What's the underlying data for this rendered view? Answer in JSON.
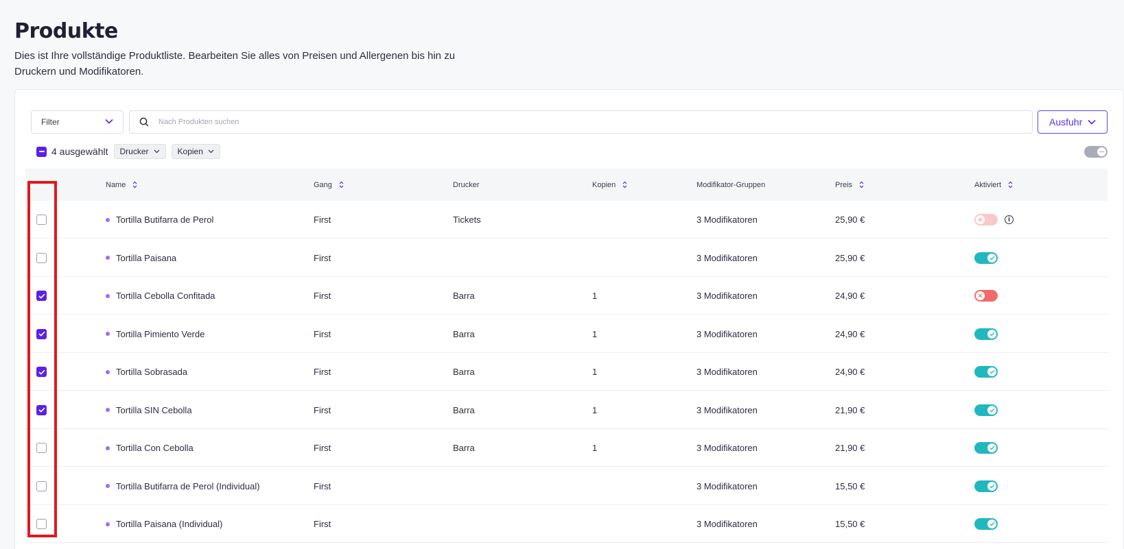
{
  "page": {
    "title": "Produkte",
    "description": "Dies ist Ihre vollständige Produktliste. Bearbeiten Sie alles von Preisen und Allergenen bis hin zu Druckern und Modifikatoren."
  },
  "toolbar": {
    "filter_label": "Filter",
    "search_placeholder": "Nach Produkten suchen",
    "action_label": "Ausfuhr"
  },
  "bulk": {
    "selected_label": "4 ausgewählt",
    "chips": [
      "Drucker",
      "Kopien"
    ]
  },
  "table": {
    "columns": {
      "name": "Name",
      "gang": "Gang",
      "drucker": "Drucker",
      "kopien": "Kopien",
      "modifikator": "Modifikator-Gruppen",
      "preis": "Preis",
      "aktiviert": "Aktiviert"
    },
    "rows": [
      {
        "checked": false,
        "name": "Tortilla Butifarra de Perol",
        "gang": "First",
        "drucker": "Tickets",
        "kopien": "",
        "modifikator": "3 Modifikatoren",
        "preis": "25,90 €",
        "aktiviert": "off-light",
        "info": true
      },
      {
        "checked": false,
        "name": "Tortilla Paisana",
        "gang": "First",
        "drucker": "",
        "kopien": "",
        "modifikator": "3 Modifikatoren",
        "preis": "25,90 €",
        "aktiviert": "on"
      },
      {
        "checked": true,
        "name": "Tortilla Cebolla Confitada",
        "gang": "First",
        "drucker": "Barra",
        "kopien": "1",
        "modifikator": "3 Modifikatoren",
        "preis": "24,90 €",
        "aktiviert": "off"
      },
      {
        "checked": true,
        "name": "Tortilla Pimiento Verde",
        "gang": "First",
        "drucker": "Barra",
        "kopien": "1",
        "modifikator": "3 Modifikatoren",
        "preis": "24,90 €",
        "aktiviert": "on"
      },
      {
        "checked": true,
        "name": "Tortilla Sobrasada",
        "gang": "First",
        "drucker": "Barra",
        "kopien": "1",
        "modifikator": "3 Modifikatoren",
        "preis": "24,90 €",
        "aktiviert": "on"
      },
      {
        "checked": true,
        "name": "Tortilla SIN Cebolla",
        "gang": "First",
        "drucker": "Barra",
        "kopien": "1",
        "modifikator": "3 Modifikatoren",
        "preis": "21,90 €",
        "aktiviert": "on"
      },
      {
        "checked": false,
        "name": "Tortilla Con Cebolla",
        "gang": "First",
        "drucker": "Barra",
        "kopien": "1",
        "modifikator": "3 Modifikatoren",
        "preis": "21,90 €",
        "aktiviert": "on"
      },
      {
        "checked": false,
        "name": "Tortilla Butifarra de Perol (Individual)",
        "gang": "First",
        "drucker": "",
        "kopien": "",
        "modifikator": "3 Modifikatoren",
        "preis": "15,50 €",
        "aktiviert": "on"
      },
      {
        "checked": false,
        "name": "Tortilla Paisana (Individual)",
        "gang": "First",
        "drucker": "",
        "kopien": "",
        "modifikator": "3 Modifikatoren",
        "preis": "15,50 €",
        "aktiviert": "on"
      }
    ]
  },
  "colors": {
    "accent": "#5b21e6",
    "toggle_on": "#21b8bd",
    "toggle_off": "#f26b6b",
    "highlight": "#e0181e",
    "name_dot": "#9b6ef3"
  }
}
